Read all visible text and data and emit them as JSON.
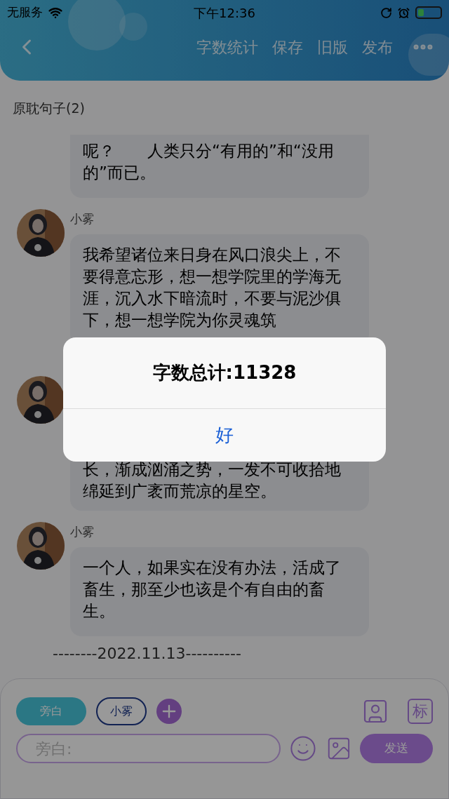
{
  "status_bar": {
    "carrier": "无服务",
    "time": "下午12:36"
  },
  "nav": {
    "actions": [
      "字数统计",
      "保存",
      "旧版",
      "发布"
    ]
  },
  "title": "原耽句子(2)",
  "messages": [
    {
      "kind": "tail",
      "text": "呢？　　人类只分“有用的”和“没用的”而已。"
    },
    {
      "kind": "full",
      "name": "小雾",
      "text": "我希望诸位来日身在风口浪尖上，不要得意忘形，想一想学院里的学海无涯，沉入水下暗流时，不要与泥沙俱下，想一想学院为你灵魂筑"
    },
    {
      "kind": "covered",
      "text": "长，渐成汹涌之势，一发不可收拾地绵延到广袤而荒凉的星空。"
    },
    {
      "kind": "full",
      "name": "小雾",
      "text": "一个人，如果实在没有办法，活成了畜生，那至少也该是个有自由的畜生。"
    }
  ],
  "date_divider": "--------2022.11.13----------",
  "composer": {
    "speakers": [
      {
        "label": "旁白",
        "selected": true
      },
      {
        "label": "小雾",
        "selected": false
      }
    ],
    "tag_button": "标",
    "placeholder": "旁白:",
    "send": "发送"
  },
  "alert": {
    "message": "字数总计:11328",
    "button": "好"
  }
}
